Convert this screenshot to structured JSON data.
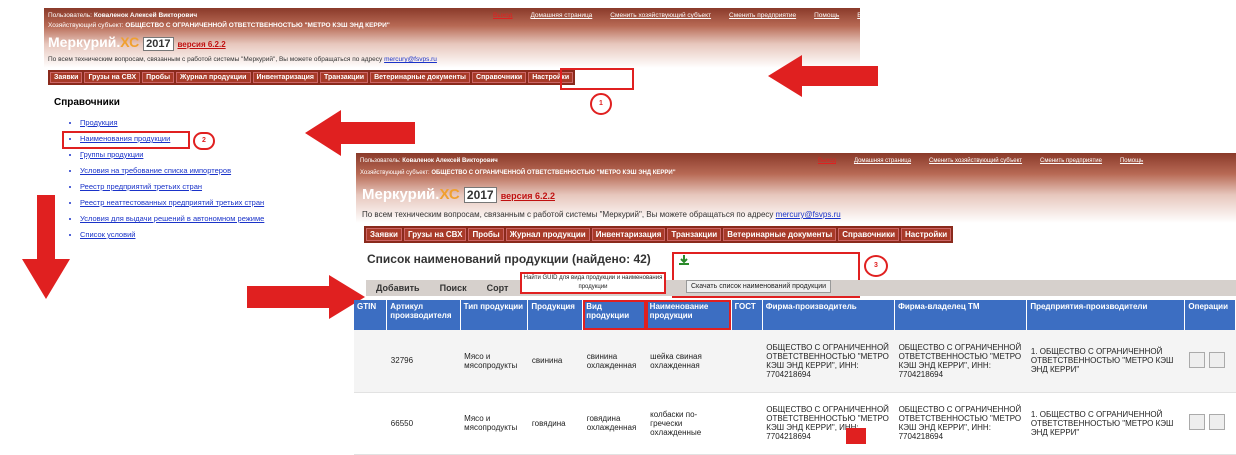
{
  "screen1": {
    "user_label": "Пользователь:",
    "user_name": "Коваленок Алексей Викторович",
    "subject_label": "Хозяйствующий субъект:",
    "subject_name": "ОБЩЕСТВО С ОГРАНИЧЕННОЙ ОТВЕТСТВЕННОСТЬЮ \"МЕТРО КЭШ ЭНД КЕРРИ\"",
    "top_links": [
      "Выход",
      "Домашняя страница",
      "Сменить хозяйствующий субъект",
      "Сменить предприятие",
      "Помощь",
      "Выход"
    ],
    "app_name": "Меркурий.",
    "app_suffix": "ХС",
    "year": "2017",
    "version": "версия 6.2.2",
    "support_text": "По всем техническим вопросам, связанным с работой системы \"Меркурий\", Вы можете обращаться по адресу",
    "support_email": "mercury@fsvps.ru",
    "menu": [
      "Заявки",
      "Грузы на СВХ",
      "Пробы",
      "Журнал продукции",
      "Инвентаризация",
      "Транзакции",
      "Ветеринарные документы",
      "Справочники",
      "Настройки"
    ],
    "section_title": "Справочники",
    "directory_items": [
      "Продукция",
      "Наименования продукции",
      "Группы продукции",
      "Условия на требование списка импортеров",
      "Реестр предприятий третьих стран",
      "Реестр неаттестованных предприятий третьих стран",
      "Условия для выдачи решений в автономном режиме",
      "Список условий"
    ]
  },
  "screen2": {
    "user_label": "Пользователь:",
    "user_name": "Коваленок Алексей Викторович",
    "subject_label": "Хозяйствующий субъект:",
    "subject_name": "ОБЩЕСТВО С ОГРАНИЧЕННОЙ ОТВЕТСТВЕННОСТЬЮ \"МЕТРО КЭШ ЭНД КЕРРИ\"",
    "top_links": [
      "Выход",
      "Домашняя страница",
      "Сменить хозяйствующий субъект",
      "Сменить предприятие",
      "Помощь",
      "Выход"
    ],
    "app_name": "Меркурий.",
    "app_suffix": "ХС",
    "year": "2017",
    "version": "версия 6.2.2",
    "support_text": "По всем техническим вопросам, связанным с работой системы \"Меркурий\", Вы можете обращаться по адресу",
    "support_email": "mercury@fsvps.ru",
    "menu": [
      "Заявки",
      "Грузы на СВХ",
      "Пробы",
      "Журнал продукции",
      "Инвентаризация",
      "Транзакции",
      "Ветеринарные документы",
      "Справочники",
      "Настройки"
    ],
    "list_title": "Список наименований продукции (найдено: 42)",
    "buttons": [
      "Добавить",
      "Поиск",
      "Сорт"
    ],
    "tooltip": "Найти GUID для вида продукции и наименования продукции",
    "download_button": "Скачать список наименований продукции",
    "columns": [
      "GTIN",
      "Артикул производителя",
      "Тип продукции",
      "Продукция",
      "Вид продукции",
      "Наименование продукции",
      "ГОСТ",
      "Фирма-производитель",
      "Фирма-владелец ТМ",
      "Предприятия-производители",
      "Операции"
    ],
    "rows": [
      {
        "gtin": "",
        "article": "32796",
        "type": "Мясо и мясопродукты",
        "product": "свинина",
        "kind": "свинина охлажденная",
        "name": "шейка свиная охлажденная",
        "gost": "",
        "maker": "ОБЩЕСТВО С ОГРАНИЧЕННОЙ ОТВЕТСТВЕННОСТЬЮ \"МЕТРО КЭШ ЭНД КЕРРИ\", ИНН: 7704218694",
        "owner": "ОБЩЕСТВО С ОГРАНИЧЕННОЙ ОТВЕТСТВЕННОСТЬЮ \"МЕТРО КЭШ ЭНД КЕРРИ\", ИНН: 7704218694",
        "plants": "1. ОБЩЕСТВО С ОГРАНИЧЕННОЙ ОТВЕТСТВЕННОСТЬЮ \"МЕТРО КЭШ ЭНД КЕРРИ\""
      },
      {
        "gtin": "",
        "article": "66550",
        "type": "Мясо и мясопродукты",
        "product": "говядина",
        "kind": "говядина охлажденная",
        "name": "колбаски по-гречески охлажденные",
        "gost": "",
        "maker": "ОБЩЕСТВО С ОГРАНИЧЕННОЙ ОТВЕТСТВЕННОСТЬЮ \"МЕТРО КЭШ ЭНД КЕРРИ\", ИНН: 7704218694",
        "owner": "ОБЩЕСТВО С ОГРАНИЧЕННОЙ ОТВЕТСТВЕННОСТЬЮ \"МЕТРО КЭШ ЭНД КЕРРИ\", ИНН: 7704218694",
        "plants": "1. ОБЩЕСТВО С ОГРАНИЧЕННОЙ ОТВЕТСТВЕННОСТЬЮ \"МЕТРО КЭШ ЭНД КЕРРИ\""
      }
    ]
  },
  "callouts": [
    "1",
    "2",
    "3"
  ],
  "colors": {
    "menu": "#8a2a1c",
    "header_grad": "#b86a55",
    "accent_red": "#e02020",
    "table_header": "#3c6ec2",
    "link": "#1a33c9"
  }
}
